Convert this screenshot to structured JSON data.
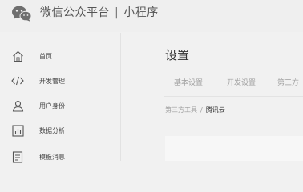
{
  "header": {
    "brand_name": "微信公众平台",
    "separator": "|",
    "product_name": "小程序",
    "logo_icon": "wechat-logo-icon"
  },
  "sidebar": {
    "items": [
      {
        "label": "首页",
        "icon": "home-icon"
      },
      {
        "label": "开发管理",
        "icon": "code-icon"
      },
      {
        "label": "用户身份",
        "icon": "user-icon"
      },
      {
        "label": "数据分析",
        "icon": "chart-icon"
      },
      {
        "label": "模板消息",
        "icon": "document-icon"
      }
    ]
  },
  "main": {
    "title": "设置",
    "tabs": [
      {
        "label": "基本设置"
      },
      {
        "label": "开发设置"
      },
      {
        "label": "第三方"
      }
    ],
    "breadcrumb": {
      "parent": "第三方工具",
      "separator": "/",
      "current": "腾讯云"
    }
  },
  "colors": {
    "background": "#f1f1f1",
    "text_dark": "#333333",
    "text_muted": "#a0a0a0",
    "icon": "#555555"
  }
}
